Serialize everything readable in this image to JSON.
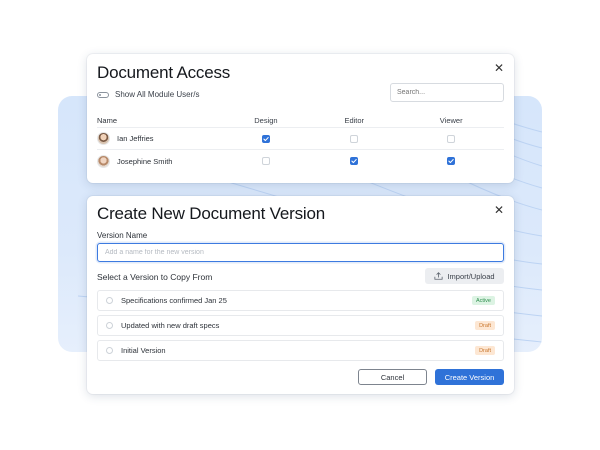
{
  "colors": {
    "accent": "#2f72d8",
    "active_badge_bg": "#dcf3e3",
    "active_badge_text": "#2f8f4e",
    "draft_badge_bg": "#fde7d3",
    "draft_badge_text": "#c9772f",
    "background_panel": "#d6e6fb"
  },
  "access_dialog": {
    "title": "Document Access",
    "close_icon": "close-icon",
    "toggle_label": "Show All Module User/s",
    "toggle_on": false,
    "search": {
      "placeholder": "Search..."
    },
    "columns": [
      "Name",
      "Design",
      "Editor",
      "Viewer"
    ],
    "users": [
      {
        "name": "Ian Jeffries",
        "design": true,
        "editor": false,
        "viewer": false
      },
      {
        "name": "Josephine Smith",
        "design": false,
        "editor": true,
        "viewer": true
      }
    ]
  },
  "version_dialog": {
    "title": "Create New Document Version",
    "close_icon": "close-icon",
    "version_name_label": "Version Name",
    "version_name_value": "",
    "version_name_placeholder": "Add a name for the new version",
    "copy_from_label": "Select a Version to Copy From",
    "import_button": {
      "label": "Import/Upload",
      "icon": "upload-icon"
    },
    "versions": [
      {
        "label": "Specifications confirmed Jan 25",
        "status": "Active",
        "selected": false
      },
      {
        "label": "Updated with new draft specs",
        "status": "Draft",
        "selected": false
      },
      {
        "label": "Initial Version",
        "status": "Draft",
        "selected": false
      }
    ],
    "cancel_label": "Cancel",
    "create_label": "Create Version"
  }
}
